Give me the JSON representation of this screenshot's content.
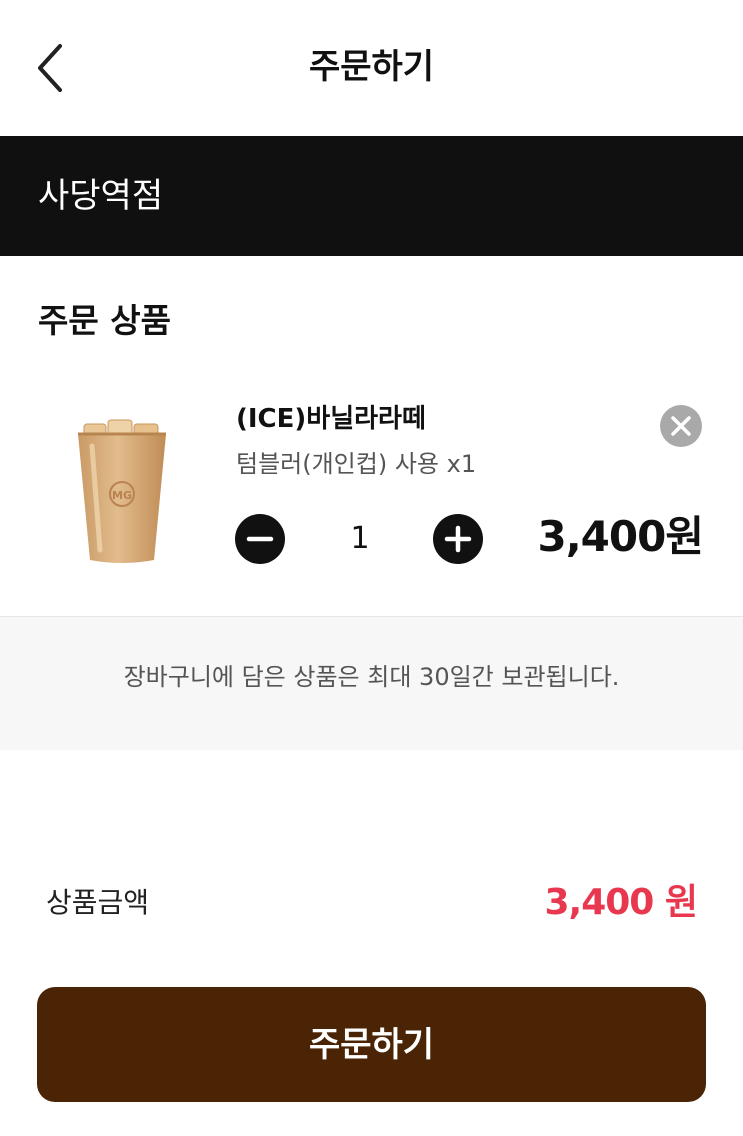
{
  "header": {
    "title": "주문하기",
    "back_icon": "chevron-left-icon"
  },
  "store": {
    "name": "사당역점"
  },
  "order_section": {
    "title": "주문 상품"
  },
  "cart_items": [
    {
      "name": "(ICE)바닐라라떼",
      "option": "텀블러(개인컵) 사용 x1",
      "quantity": "1",
      "price": "3,400원",
      "image_icon": "iced-latte-cup-icon"
    }
  ],
  "notice": {
    "text": "장바구니에 담은 상품은 최대 30일간 보관됩니다."
  },
  "summary": {
    "total_label": "상품금액",
    "total_value": "3,400 원"
  },
  "order_button": {
    "label": "주문하기"
  },
  "colors": {
    "store_bar": "#101010",
    "accent_price": "#e8384f",
    "order_button": "#4a2404",
    "remove_button": "#a9a9a9",
    "notice_bg": "#f7f7f8"
  }
}
